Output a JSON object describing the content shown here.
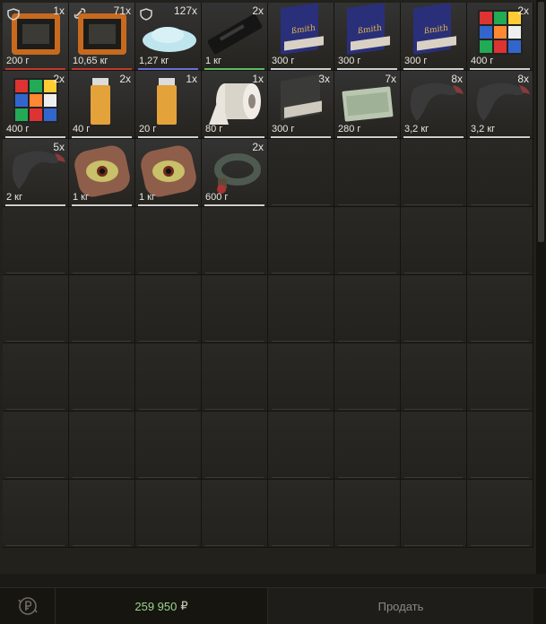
{
  "items": [
    {
      "name": "tablet-orange",
      "count": "1x",
      "weight": "200 г",
      "badge": "shield",
      "underline": "#c0392b"
    },
    {
      "name": "tablet-orange-2",
      "count": "71x",
      "weight": "10,65 кг",
      "badge": "link",
      "underline": "#c0392b"
    },
    {
      "name": "powder-pile",
      "count": "127x",
      "weight": "1,27 кг",
      "badge": "shield",
      "underline": "#6c6fd6"
    },
    {
      "name": "black-case",
      "count": "2x",
      "weight": "1 кг",
      "badge": "",
      "underline": "#5dbb63"
    },
    {
      "name": "blue-book",
      "count": "",
      "weight": "300 г",
      "badge": "",
      "underline": "#cfcfcf"
    },
    {
      "name": "blue-book-2",
      "count": "",
      "weight": "300 г",
      "badge": "",
      "underline": "#cfcfcf"
    },
    {
      "name": "blue-book-3",
      "count": "",
      "weight": "300 г",
      "badge": "",
      "underline": "#cfcfcf"
    },
    {
      "name": "rubik-cube",
      "count": "2x",
      "weight": "400 г",
      "badge": "",
      "underline": "#cfcfcf"
    },
    {
      "name": "rubik-cube-2",
      "count": "2x",
      "weight": "400 г",
      "badge": "",
      "underline": "#cfcfcf"
    },
    {
      "name": "lighter",
      "count": "2x",
      "weight": "40 г",
      "badge": "",
      "underline": "#cfcfcf"
    },
    {
      "name": "lighter-2",
      "count": "1x",
      "weight": "20 г",
      "badge": "",
      "underline": "#cfcfcf"
    },
    {
      "name": "toilet-roll",
      "count": "1x",
      "weight": "80 г",
      "badge": "",
      "underline": "#cfcfcf"
    },
    {
      "name": "dark-book",
      "count": "3x",
      "weight": "300 г",
      "badge": "",
      "underline": "#cfcfcf"
    },
    {
      "name": "money-stack",
      "count": "7x",
      "weight": "280 г",
      "badge": "",
      "underline": "#cfcfcf"
    },
    {
      "name": "horn",
      "count": "8x",
      "weight": "3,2 кг",
      "badge": "",
      "underline": "#cfcfcf"
    },
    {
      "name": "horn-2",
      "count": "8x",
      "weight": "3,2 кг",
      "badge": "",
      "underline": "#cfcfcf"
    },
    {
      "name": "horn-3",
      "count": "5x",
      "weight": "2 кг",
      "badge": "",
      "underline": "#cfcfcf"
    },
    {
      "name": "eye",
      "count": "",
      "weight": "1 кг",
      "badge": "",
      "underline": "#cfcfcf"
    },
    {
      "name": "eye-2",
      "count": "",
      "weight": "1 кг",
      "badge": "",
      "underline": "#cfcfcf"
    },
    {
      "name": "ring-rope",
      "count": "2x",
      "weight": "600 г",
      "badge": "",
      "underline": "#cfcfcf"
    }
  ],
  "empty_cells": 44,
  "footer": {
    "total_value": "259 950",
    "currency": "₽",
    "sell_label": "Продать"
  },
  "colors": {
    "accent_green": "#9bd38c",
    "background": "#23211c"
  }
}
